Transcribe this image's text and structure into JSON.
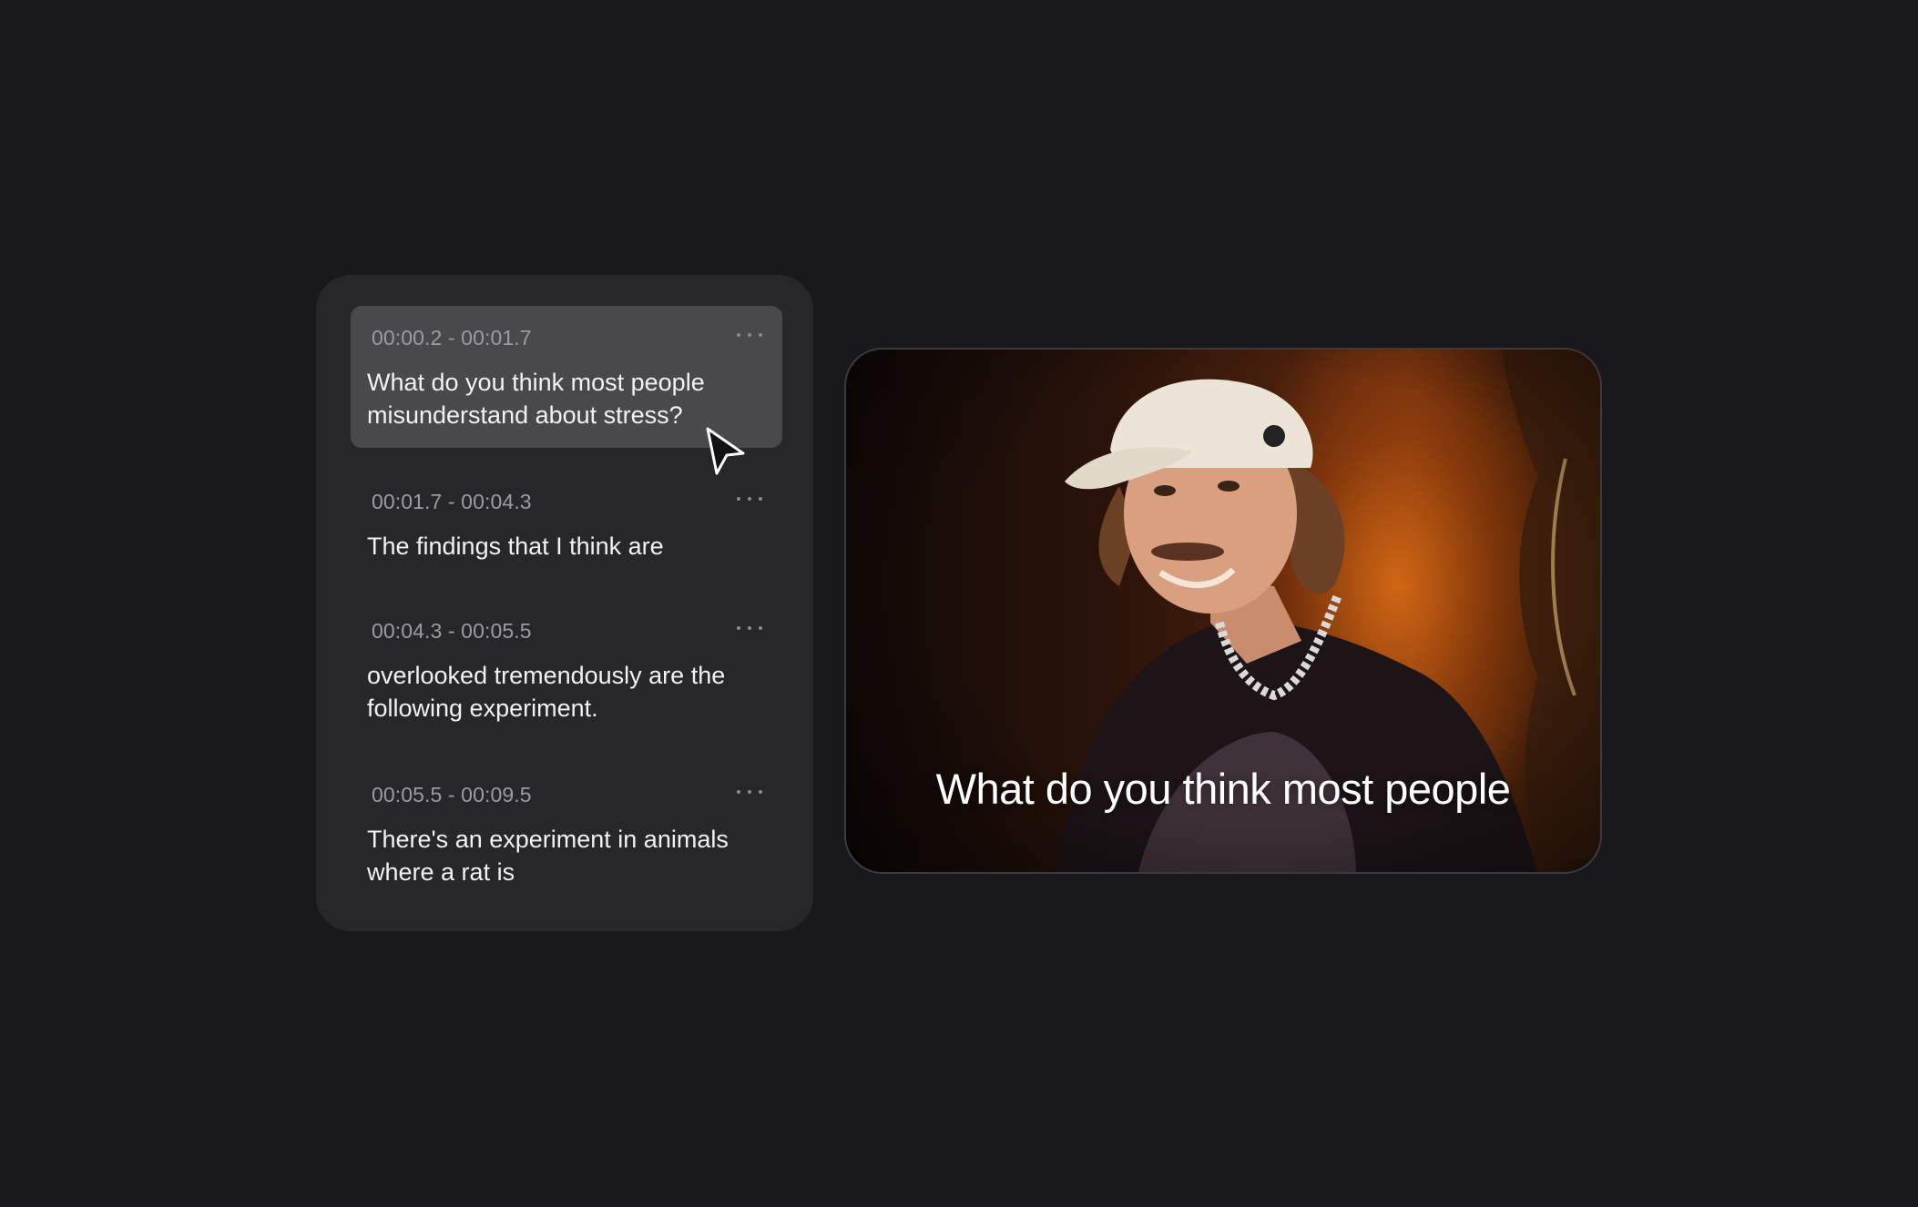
{
  "transcript": {
    "segments": [
      {
        "time": "00:00.2 - 00:01.7",
        "text": "What do you think most people misunderstand about stress?",
        "active": true
      },
      {
        "time": "00:01.7 - 00:04.3",
        "text": "The findings that I think are",
        "active": false
      },
      {
        "time": "00:04.3 - 00:05.5",
        "text": "overlooked tremendously are the following experiment.",
        "active": false
      },
      {
        "time": "00:05.5 - 00:09.5",
        "text": "There's an experiment in animals where a rat is",
        "active": false
      }
    ]
  },
  "video": {
    "caption": "What do you think most people"
  },
  "icons": {
    "segment_menu": "more-horizontal-icon",
    "cursor": "mouse-pointer-icon"
  },
  "colors": {
    "background": "#19191b",
    "panel": "#26262b",
    "active_segment": "#48484d",
    "timestamp": "#9b9ba2",
    "text": "#f2f2f4"
  }
}
